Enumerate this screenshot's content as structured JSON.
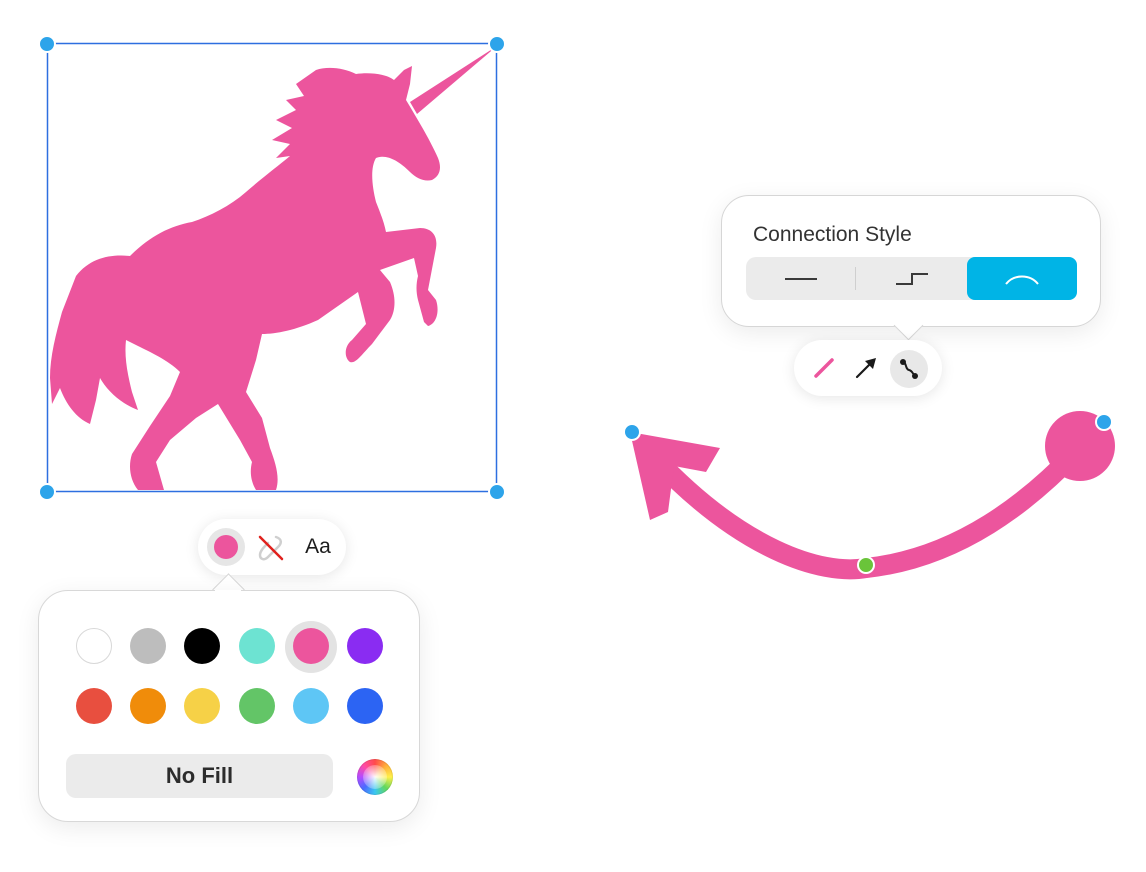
{
  "canvas": {
    "shape_name": "unicorn",
    "shape_color": "#ec559d",
    "selection_color": "#2d6fe0",
    "handle_color": "#2da4ea",
    "connector": {
      "color": "#ec559d",
      "style": "curved",
      "start_cap": "arrow",
      "end_cap": "circle",
      "midpoint_handle_color": "#6ac43a"
    }
  },
  "shape_toolbar": {
    "fill_icon": "fill-color-icon",
    "fill_color": "#ec559d",
    "stroke_icon": "no-stroke-icon",
    "text_label": "Aa"
  },
  "color_popover": {
    "swatches": [
      {
        "name": "white",
        "color": "#ffffff"
      },
      {
        "name": "gray",
        "color": "#bdbdbd"
      },
      {
        "name": "black",
        "color": "#000000"
      },
      {
        "name": "teal",
        "color": "#6de3d2"
      },
      {
        "name": "pink",
        "color": "#ec559d",
        "selected": true
      },
      {
        "name": "purple",
        "color": "#8a2cf2"
      },
      {
        "name": "red",
        "color": "#e84f3f"
      },
      {
        "name": "orange",
        "color": "#f08c0a"
      },
      {
        "name": "yellow",
        "color": "#f6d147"
      },
      {
        "name": "green",
        "color": "#63c567"
      },
      {
        "name": "sky",
        "color": "#5ec6f5"
      },
      {
        "name": "blue",
        "color": "#2c64f3"
      }
    ],
    "no_fill_label": "No Fill",
    "color_wheel_icon": "color-wheel-icon"
  },
  "connection_popover": {
    "title": "Connection Style",
    "options": [
      {
        "name": "straight",
        "icon": "straight-line-icon"
      },
      {
        "name": "corner",
        "icon": "corner-line-icon"
      },
      {
        "name": "curved",
        "icon": "curved-line-icon",
        "selected": true
      }
    ],
    "selected_color": "#00b4e6"
  },
  "connection_toolbar": {
    "items": [
      {
        "name": "line-color",
        "icon": "pink-line-icon"
      },
      {
        "name": "line-end",
        "icon": "arrow-icon"
      },
      {
        "name": "connection-style",
        "icon": "connection-style-icon",
        "selected": true
      }
    ]
  }
}
